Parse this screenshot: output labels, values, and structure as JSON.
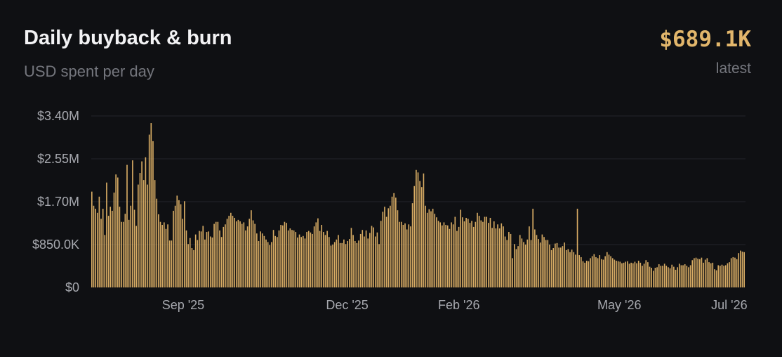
{
  "header": {
    "title": "Daily buyback & burn",
    "subtitle": "USD spent per day",
    "latest_value": "$689.1K",
    "latest_label": "latest"
  },
  "colors": {
    "background": "#0f1013",
    "bar": "#d8ac64",
    "grid": "#23252b",
    "accent": "#e2b66b"
  },
  "chart_data": {
    "type": "bar",
    "x_start": "2025-07-12",
    "x_end": "2026-07-10",
    "ylim": [
      0,
      3400000
    ],
    "y_ticks": [
      {
        "value": 0,
        "label": "$0"
      },
      {
        "value": 850000,
        "label": "$850.0K"
      },
      {
        "value": 1700000,
        "label": "$1.70M"
      },
      {
        "value": 2550000,
        "label": "$2.55M"
      },
      {
        "value": 3400000,
        "label": "$3.40M"
      }
    ],
    "x_ticks": [
      {
        "date": "2025-09-01",
        "label": "Sep '25"
      },
      {
        "date": "2025-12-01",
        "label": "Dec '25"
      },
      {
        "date": "2026-02-01",
        "label": "Feb '26"
      },
      {
        "date": "2026-05-01",
        "label": "May '26"
      },
      {
        "date": "2026-07-01",
        "label": "Jul '26"
      }
    ],
    "grid": true,
    "values": [
      1900000,
      1620000,
      1560000,
      1480000,
      1800000,
      1360000,
      1560000,
      1040000,
      2080000,
      1420000,
      1600000,
      1520000,
      1880000,
      2240000,
      2180000,
      1600000,
      1300000,
      1300000,
      1460000,
      2430000,
      1340000,
      1620000,
      2520000,
      1540000,
      1220000,
      2040000,
      2270000,
      2500000,
      2130000,
      2580000,
      2040000,
      3030000,
      3260000,
      2900000,
      2130000,
      1760000,
      1450000,
      1300000,
      1240000,
      1290000,
      1160000,
      1250000,
      930000,
      930000,
      1520000,
      1620000,
      1820000,
      1730000,
      1650000,
      1360000,
      1710000,
      1130000,
      860000,
      980000,
      780000,
      740000,
      1050000,
      940000,
      1120000,
      1110000,
      1220000,
      950000,
      1100000,
      1110000,
      1010000,
      990000,
      1260000,
      1300000,
      1300000,
      1130000,
      1000000,
      1200000,
      1250000,
      1360000,
      1420000,
      1480000,
      1420000,
      1380000,
      1310000,
      1340000,
      1310000,
      1260000,
      1290000,
      1130000,
      1210000,
      1360000,
      1530000,
      1330000,
      1260000,
      1070000,
      920000,
      1110000,
      1070000,
      1020000,
      950000,
      900000,
      840000,
      900000,
      1140000,
      1020000,
      1000000,
      1130000,
      1240000,
      1230000,
      1300000,
      1280000,
      1130000,
      1170000,
      1140000,
      1130000,
      1100000,
      990000,
      1050000,
      1000000,
      1020000,
      970000,
      1100000,
      1120000,
      1090000,
      1060000,
      1210000,
      1290000,
      1370000,
      1120000,
      1240000,
      1100000,
      1040000,
      1120000,
      1000000,
      830000,
      850000,
      900000,
      950000,
      1040000,
      880000,
      880000,
      950000,
      860000,
      920000,
      960000,
      1180000,
      1040000,
      920000,
      880000,
      930000,
      1060000,
      1140000,
      1010000,
      1130000,
      970000,
      1080000,
      1220000,
      1190000,
      1010000,
      1090000,
      860000,
      1320000,
      1500000,
      1600000,
      1400000,
      1570000,
      1620000,
      1800000,
      1870000,
      1780000,
      1530000,
      1300000,
      1300000,
      1240000,
      1270000,
      1150000,
      1250000,
      1210000,
      1670000,
      2010000,
      2330000,
      2280000,
      2110000,
      1990000,
      2260000,
      1620000,
      1480000,
      1550000,
      1510000,
      1560000,
      1460000,
      1390000,
      1320000,
      1290000,
      1230000,
      1290000,
      1240000,
      1230000,
      1160000,
      1290000,
      1250000,
      1400000,
      1120000,
      1200000,
      1540000,
      1390000,
      1310000,
      1380000,
      1360000,
      1280000,
      1320000,
      1200000,
      1300000,
      1480000,
      1420000,
      1330000,
      1300000,
      1400000,
      1400000,
      1280000,
      1380000,
      1180000,
      1310000,
      1170000,
      1250000,
      1170000,
      1270000,
      1210000,
      1010000,
      940000,
      1100000,
      1060000,
      580000,
      860000,
      760000,
      820000,
      1040000,
      970000,
      900000,
      850000,
      950000,
      1210000,
      940000,
      1560000,
      1150000,
      1040000,
      960000,
      890000,
      1050000,
      1000000,
      940000,
      940000,
      850000,
      740000,
      780000,
      870000,
      880000,
      790000,
      790000,
      820000,
      890000,
      740000,
      760000,
      700000,
      750000,
      700000,
      650000,
      1560000,
      640000,
      600000,
      520000,
      490000,
      530000,
      520000,
      580000,
      620000,
      660000,
      600000,
      580000,
      640000,
      560000,
      550000,
      620000,
      700000,
      650000,
      620000,
      580000,
      550000,
      530000,
      520000,
      510000,
      480000,
      490000,
      510000,
      520000,
      470000,
      490000,
      480000,
      510000,
      480000,
      530000,
      490000,
      430000,
      470000,
      540000,
      500000,
      410000,
      390000,
      330000,
      390000,
      400000,
      460000,
      430000,
      430000,
      470000,
      430000,
      400000,
      380000,
      450000,
      410000,
      350000,
      400000,
      470000,
      440000,
      440000,
      460000,
      430000,
      400000,
      440000,
      540000,
      580000,
      590000,
      570000,
      560000,
      590000,
      490000,
      550000,
      580000,
      500000,
      480000,
      490000,
      360000,
      340000,
      440000,
      430000,
      450000,
      430000,
      440000,
      480000,
      500000,
      580000,
      600000,
      590000,
      560000,
      680000,
      730000,
      710000,
      700000
    ]
  }
}
